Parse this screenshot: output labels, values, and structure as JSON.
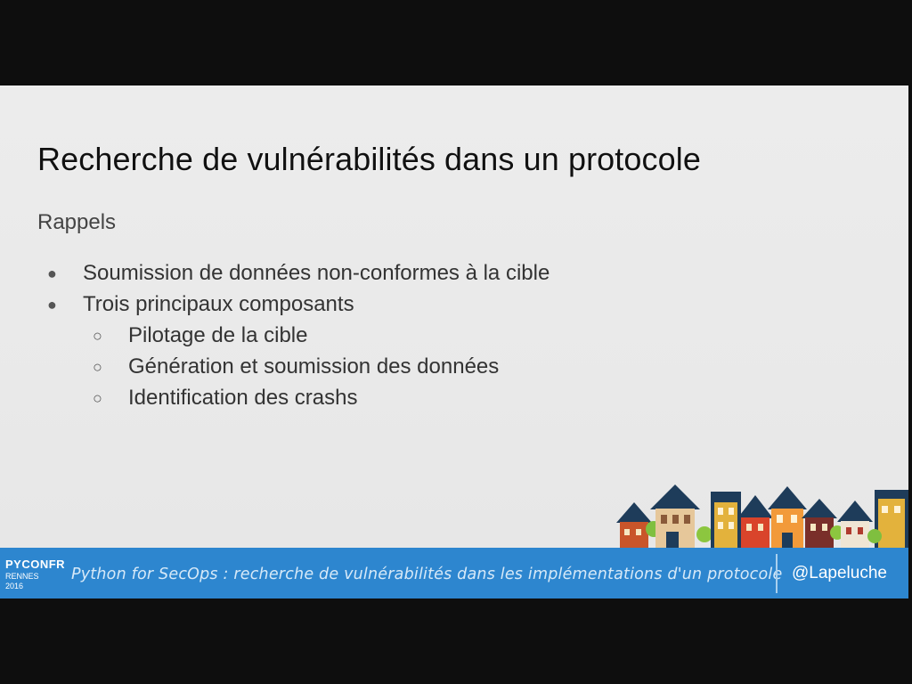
{
  "slide": {
    "title": "Recherche de vulnérabilités dans un protocole",
    "subtitle": "Rappels",
    "bullets": [
      {
        "level": 1,
        "marker": "●",
        "text": "Soumission de données non-conformes à la cible"
      },
      {
        "level": 1,
        "marker": "●",
        "text": "Trois principaux composants"
      },
      {
        "level": 2,
        "marker": "○",
        "text": "Pilotage de la cible"
      },
      {
        "level": 2,
        "marker": "○",
        "text": "Génération et soumission des données"
      },
      {
        "level": 2,
        "marker": "○",
        "text": "Identification des crashs"
      }
    ]
  },
  "footer": {
    "logo": {
      "line1": "PYCONFR",
      "line2": "RENNES 2016"
    },
    "text": "Python for SecOps : recherche de vulnérabilités dans les implémentations d'un protocole",
    "handle": "@Lapeluche"
  },
  "colors": {
    "footer_bg": "#2d86cf",
    "slide_bg": "#ececec",
    "frame_bg": "#0e0e0e"
  }
}
